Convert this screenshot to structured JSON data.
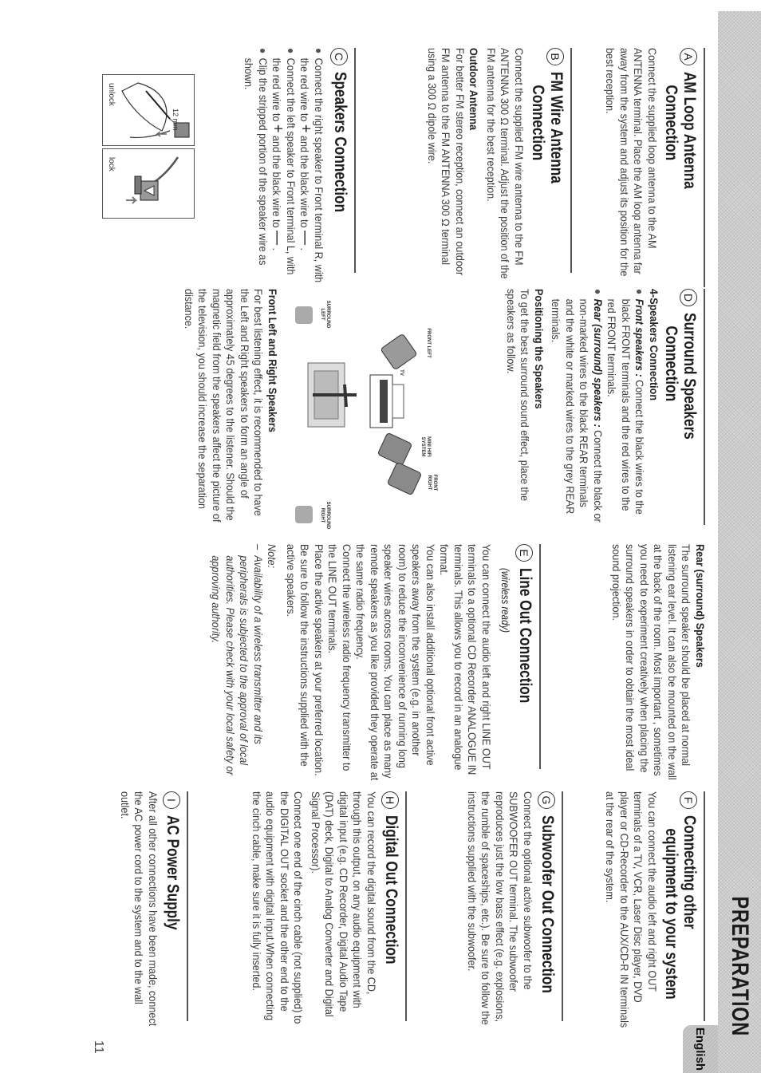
{
  "header": {
    "section_title": "PREPARATION",
    "language_tab": "English"
  },
  "page_number": "11",
  "sections": {
    "A": {
      "letter": "A",
      "title_line1": "AM Loop Antenna",
      "title_line2": "Connection",
      "body": "Connect the supplied loop antenna to the AM ANTENNA terminal. Place the AM loop antenna far away from the system and adjust its position for the best reception."
    },
    "B": {
      "letter": "B",
      "title_line1": "FM Wire Antenna",
      "title_line2": "Connection",
      "body": "Connect the supplied FM wire antenna to the FM ANTENNA 300 Ω terminal. Adjust the position of the FM antenna for the best reception.",
      "subhead": "Outdoor Antenna",
      "body2": "For better FM stereo reception, connect an outdoor FM antenna to the FM ANTENNA 300 Ω terminal using a 300 Ω dipole wire."
    },
    "C": {
      "letter": "C",
      "title": "Speakers Connection",
      "bullets": [
        {
          "pre": "Connect the right speaker to Front terminal R, with the red wire to ",
          "plus": "+",
          "mid": " and the black wire to ",
          "minus": "—",
          "post": " ."
        },
        {
          "pre": "Connect the left speaker to Front terminal L, with the red wire to ",
          "plus": "+",
          "mid": " and the black wire to ",
          "minus": "—",
          "post": " ."
        },
        {
          "text": "Clip the stripped portion of the speaker wire as shown."
        }
      ],
      "figure": {
        "measure_label": "12 mm",
        "unlock_label": "unlock",
        "lock_label": "lock"
      }
    },
    "D": {
      "letter": "D",
      "title_line1": "Surround Speakers",
      "title_line2": "Connection",
      "subhead": "4-Speakers Connection",
      "bullets": [
        {
          "lead": "Front speakers :",
          "text": " Connect the black wires to the black FRONT terminals and the red wires to the red FRONT terminals."
        },
        {
          "lead": "Rear (surround) speakers :",
          "text": " Connect the black or non-marked wires to the black REAR terminals and the white or marked wires to the grey REAR terminals."
        }
      ],
      "positioning_head": "Positioning the Speakers",
      "positioning_body": "To get the best surround sound effect, place the speakers as follow.",
      "diagram_labels": {
        "front_left": "FRONT LEFT",
        "front_right": "FRONT RIGHT",
        "tv": "TV",
        "mini_hifi": "MINI HIFI SYSTEM",
        "surround_left": "SURROUND LEFT",
        "surround_right": "SURROUND RIGHT"
      },
      "front_head": "Front Left and Right Speakers",
      "front_body": "For best listening effect, it is recommended to have the Left and Right speakers to form an angle of approximately 45 degrees to the listener. Should the magnetic field from the speakers affect the picture of the television, you should increase the separation distance.",
      "rear_head": "Rear (surround) Speakers",
      "rear_body": "The surround speaker should be placed at normal listening ear level. It can also be mounted on the wall at the back of the room. Most important , sometimes you need to experiment creatively when placing the surround speakers in order to obtain the most ideal sound projection."
    },
    "E": {
      "letter": "E",
      "title": "Line Out Connection",
      "title_note": "(wireless ready)",
      "body1": "You can connect the audio left and right LINE OUT terminals to a optional CD Recorder ANALOGUE IN terminals. This allows you to record in an analogue format.",
      "body2": "You can also install additional optional front active speakers away from the system (e.g. in another room) to reduce the inconvenience of running long speaker wires across rooms. You can place as many remote speakers as you like provided they operate at the same radio frequency.",
      "body3": "Connect the wireless radio frequency transmitter to the LINE OUT terminals.",
      "body4": "Place the active speakers at your preferred location. Be sure to follow the instructions supplied with the active speakers.",
      "note_label": "Note:",
      "note_dash": "–",
      "note_text": "Availability of a wireless transmitter and its peripherals is subjected to the approval of local authorities. Please check with your local safety or approving authority."
    },
    "F": {
      "letter": "F",
      "title_line1": "Connecting other",
      "title_line2": "equipment to your system",
      "body": "You can connect the audio left and right OUT terminals of a TV, VCR, Laser Disc player, DVD player or CD-Recorder to the AUX/CD-R IN terminals at the rear of the system."
    },
    "G": {
      "letter": "G",
      "title": "Subwoofer Out Connection",
      "body": "Connect the optional active subwoofer to the SUBWOOFER OUT terminal. The subwoofer reproduces just the low bass effect (e.g. explosions, the rumble of spaceships, etc.). Be sure to follow the instructions supplied with the subwoofer."
    },
    "H": {
      "letter": "H",
      "title": "Digital Out Connection",
      "body1": "You can record the digital sound from the CD, through this output, on any audio equipment with digital input (e.g. CD Recorder, Digital Audio Tape (DAT) deck, Digital to Analog Converter and Digital Signal Processor).",
      "body2": "Connect one end of the cinch cable (not supplied) to the DIGITAL OUT socket and the other end to the audio equipment with digital input.When connecting the cinch cable, make sure it is fully inserted."
    },
    "I": {
      "letter": "I",
      "title": "AC Power Supply",
      "body": "After all other connections have been made, connect the AC power cord to the system and to the wall outlet."
    }
  }
}
